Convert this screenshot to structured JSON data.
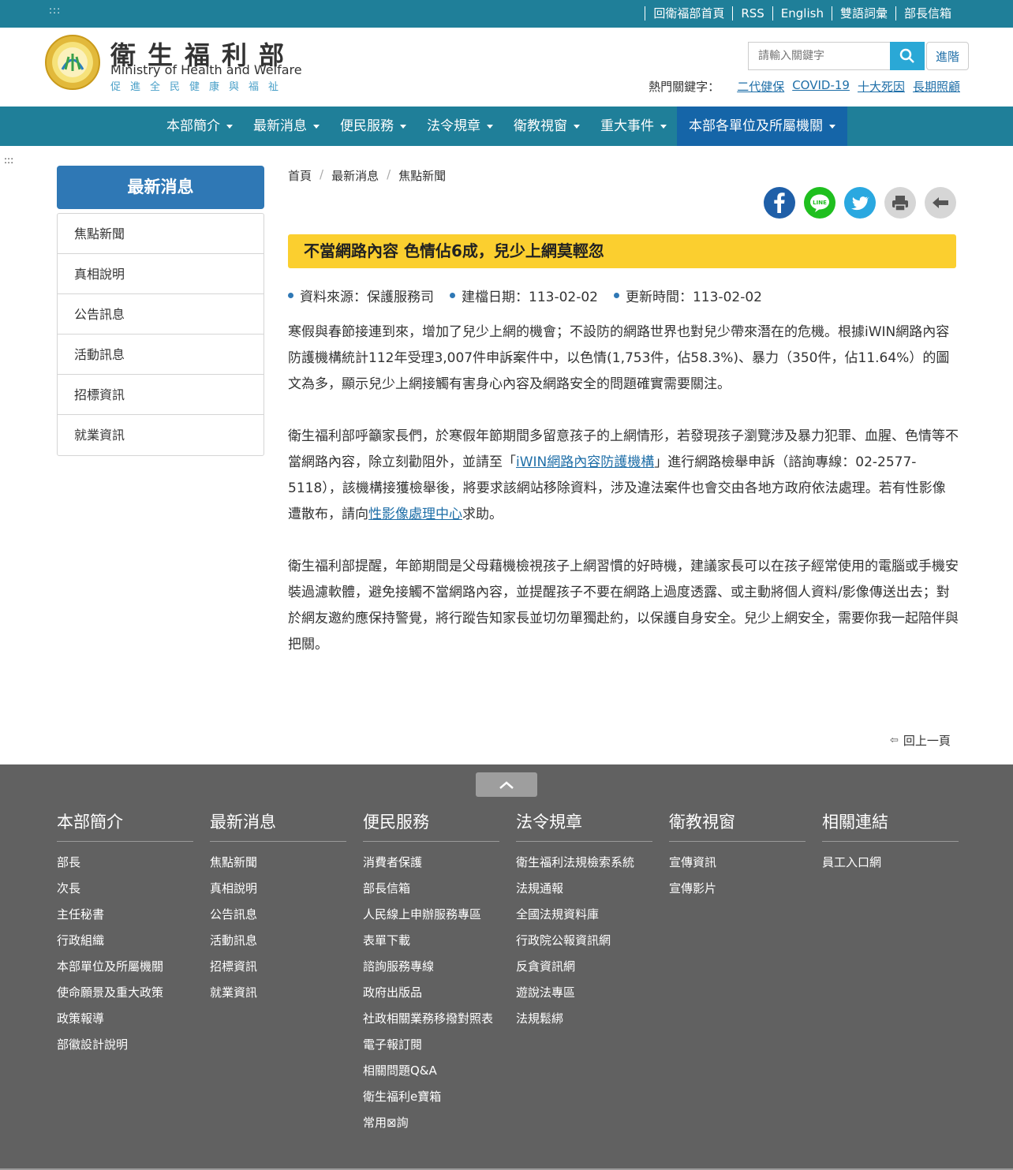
{
  "topbar": {
    "accesskey": ":::",
    "links": [
      "回衛福部首頁",
      "RSS",
      "English",
      "雙語詞彙",
      "部長信箱"
    ]
  },
  "header": {
    "logo_cn": "衛生福利部",
    "logo_en": "Ministry of Health and Welfare",
    "logo_sub": "促進全民健康與福祉",
    "search_placeholder": "請輸入關鍵字",
    "advanced_label": "進階",
    "hot_label": "熱門關鍵字：",
    "hot_keywords": [
      "二代健保",
      "COVID-19",
      "十大死因",
      "長期照顧"
    ]
  },
  "nav": {
    "items": [
      "本部簡介",
      "最新消息",
      "便民服務",
      "法令規章",
      "衛教視窗",
      "重大事件",
      "本部各單位及所屬機關"
    ]
  },
  "content_accesskey": ":::",
  "sidebar": {
    "title": "最新消息",
    "items": [
      "焦點新聞",
      "真相說明",
      "公告訊息",
      "活動訊息",
      "招標資訊",
      "就業資訊"
    ]
  },
  "breadcrumb": [
    "首頁",
    "最新消息",
    "焦點新聞"
  ],
  "article": {
    "title": "不當網路內容 色情佔6成，兒少上網莫輕忽",
    "meta": [
      "資料來源：保護服務司",
      "建檔日期：113-02-02",
      "更新時間：113-02-02"
    ],
    "p1": "寒假與春節接連到來，增加了兒少上網的機會；不設防的網路世界也對兒少帶來潛在的危機。根據iWIN網路內容防護機構統計112年受理3,007件申訴案件中，以色情(1,753件，佔58.3%)、暴力（350件，佔11.64%）的圖文為多，顯示兒少上網接觸有害身心內容及網路安全的問題確實需要關注。",
    "p2a": "衛生福利部呼籲家長們，於寒假年節期間多留意孩子的上網情形，若發現孩子瀏覽涉及暴力犯罪、血腥、色情等不當網路內容，除立刻勸阻外，並請至「",
    "p2_link1": "iWIN網路內容防護機構",
    "p2b": "」進行網路檢舉申訴（諮詢專線：02-2577-5118），該機構接獲檢舉後，將要求該網站移除資料，涉及違法案件也會交由各地方政府依法處理。若有性影像遭散布，請向",
    "p2_link2": "性影像處理中心",
    "p2c": "求助。",
    "p3": "衛生福利部提醒，年節期間是父母藉機檢視孩子上網習慣的好時機，建議家長可以在孩子經常使用的電腦或手機安裝過濾軟體，避免接觸不當網路內容，並提醒孩子不要在網路上過度透露、或主動將個人資料/影像傳送出去；對於網友邀約應保持警覺，將行蹤告知家長並切勿單獨赴約，以保護自身安全。兒少上網安全，需要你我一起陪伴與把關。",
    "back": "回上一頁"
  },
  "footer": {
    "columns": [
      {
        "heading": "本部簡介",
        "links": [
          "部長",
          "次長",
          "主任秘書",
          "行政組織",
          "本部單位及所屬機關",
          "使命願景及重大政策",
          "政策報導",
          "部徽設計說明"
        ]
      },
      {
        "heading": "最新消息",
        "links": [
          "焦點新聞",
          "真相說明",
          "公告訊息",
          "活動訊息",
          "招標資訊",
          "就業資訊"
        ]
      },
      {
        "heading": "便民服務",
        "links": [
          "消費者保護",
          "部長信箱",
          "人民線上申辦服務專區",
          "表單下載",
          "諮詢服務專線",
          "政府出版品",
          "社政相關業務移撥對照表",
          "電子報訂閱",
          "相關問題Q&A",
          "衛生福利e寶箱",
          "常用⊠詢"
        ]
      },
      {
        "heading": "法令規章",
        "links": [
          "衛生福利法規檢索系統",
          "法規通報",
          "全國法規資料庫",
          "行政院公報資訊網",
          "反貪資訊網",
          "遊說法專區",
          "法規鬆綁"
        ]
      },
      {
        "heading": "衛教視窗",
        "links": [
          "宣傳資訊",
          "宣傳影片"
        ]
      },
      {
        "heading": "相關連結",
        "links": [
          "員工入口網"
        ]
      }
    ]
  },
  "colors": {
    "brand_teal": "#1f7f99",
    "nav_active": "#1565a8",
    "title_yellow": "#fbcf2f",
    "footer_gray": "#616161"
  }
}
